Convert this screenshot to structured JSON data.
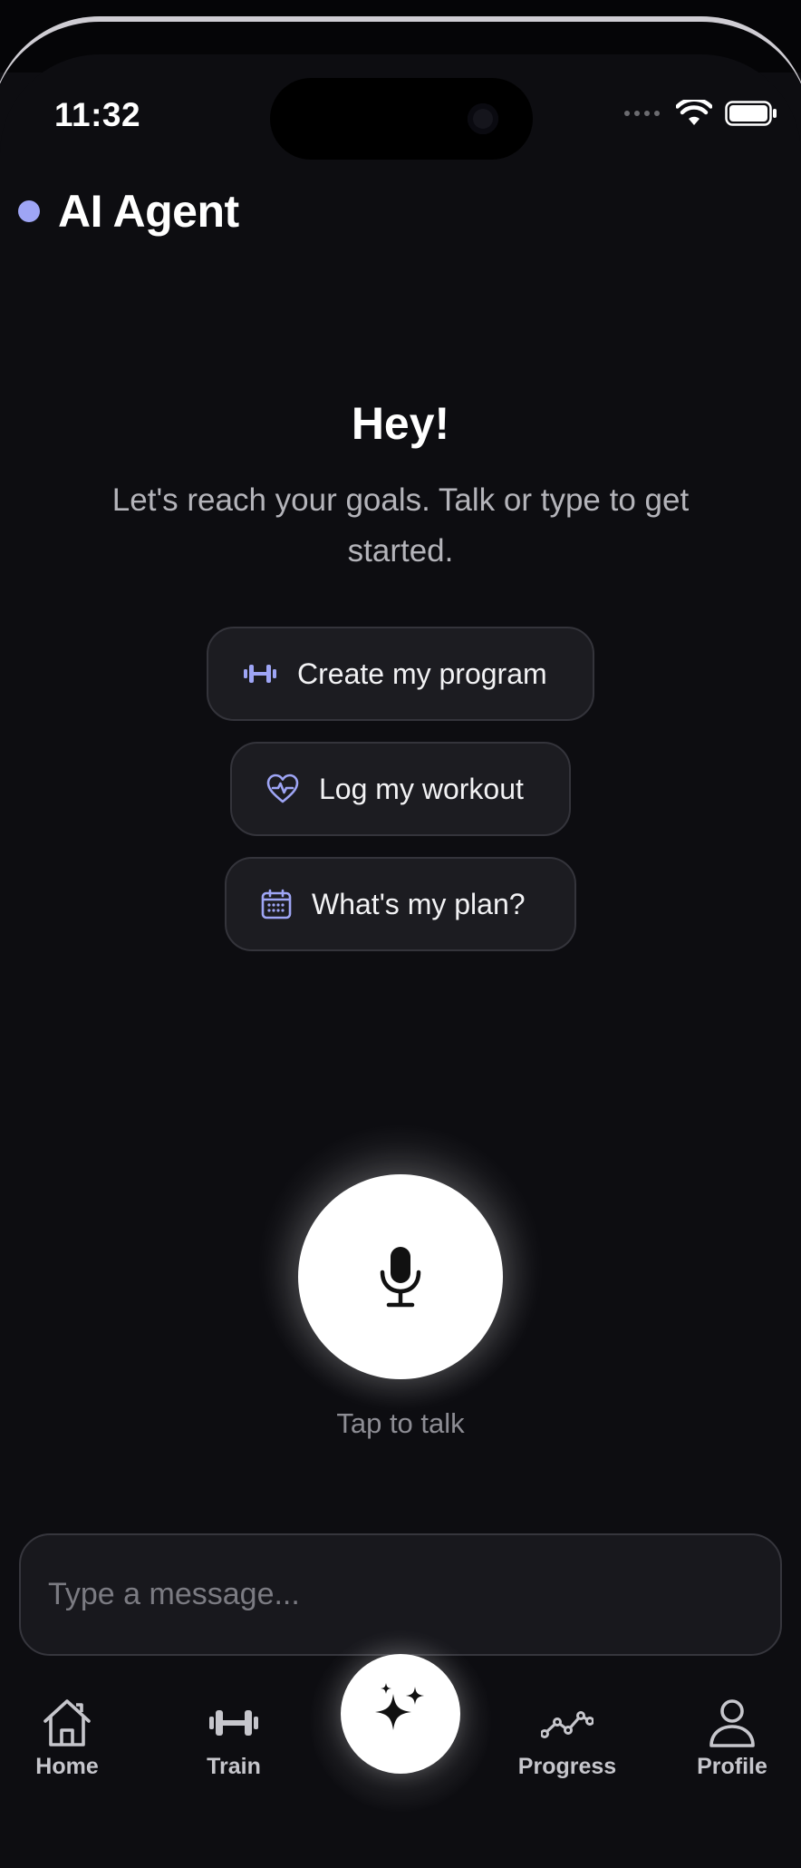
{
  "status_bar": {
    "time": "11:32"
  },
  "header": {
    "title": "AI Agent",
    "dot_color": "#9ea5f5"
  },
  "hero": {
    "greeting": "Hey!",
    "subtitle": "Let's reach your goals. Talk or type to get started."
  },
  "suggestions": [
    {
      "label": "Create my program",
      "icon": "dumbbell-icon"
    },
    {
      "label": "Log my workout",
      "icon": "heart-pulse-icon"
    },
    {
      "label": "What's my plan?",
      "icon": "calendar-icon"
    }
  ],
  "voice": {
    "label": "Tap to talk",
    "icon": "microphone-icon"
  },
  "composer": {
    "placeholder": "Type a message..."
  },
  "tabbar": {
    "items": [
      {
        "label": "Home",
        "icon": "home-icon"
      },
      {
        "label": "Train",
        "icon": "dumbbell-icon"
      },
      {
        "label": "",
        "icon": "sparkles-icon"
      },
      {
        "label": "Progress",
        "icon": "trend-line-icon"
      },
      {
        "label": "Profile",
        "icon": "person-icon"
      }
    ]
  },
  "colors": {
    "background": "#0d0d11",
    "accent": "#9ea5f5",
    "chip_background": "#1c1c21",
    "chip_border": "#34343b",
    "muted_text": "#8d8d94"
  }
}
